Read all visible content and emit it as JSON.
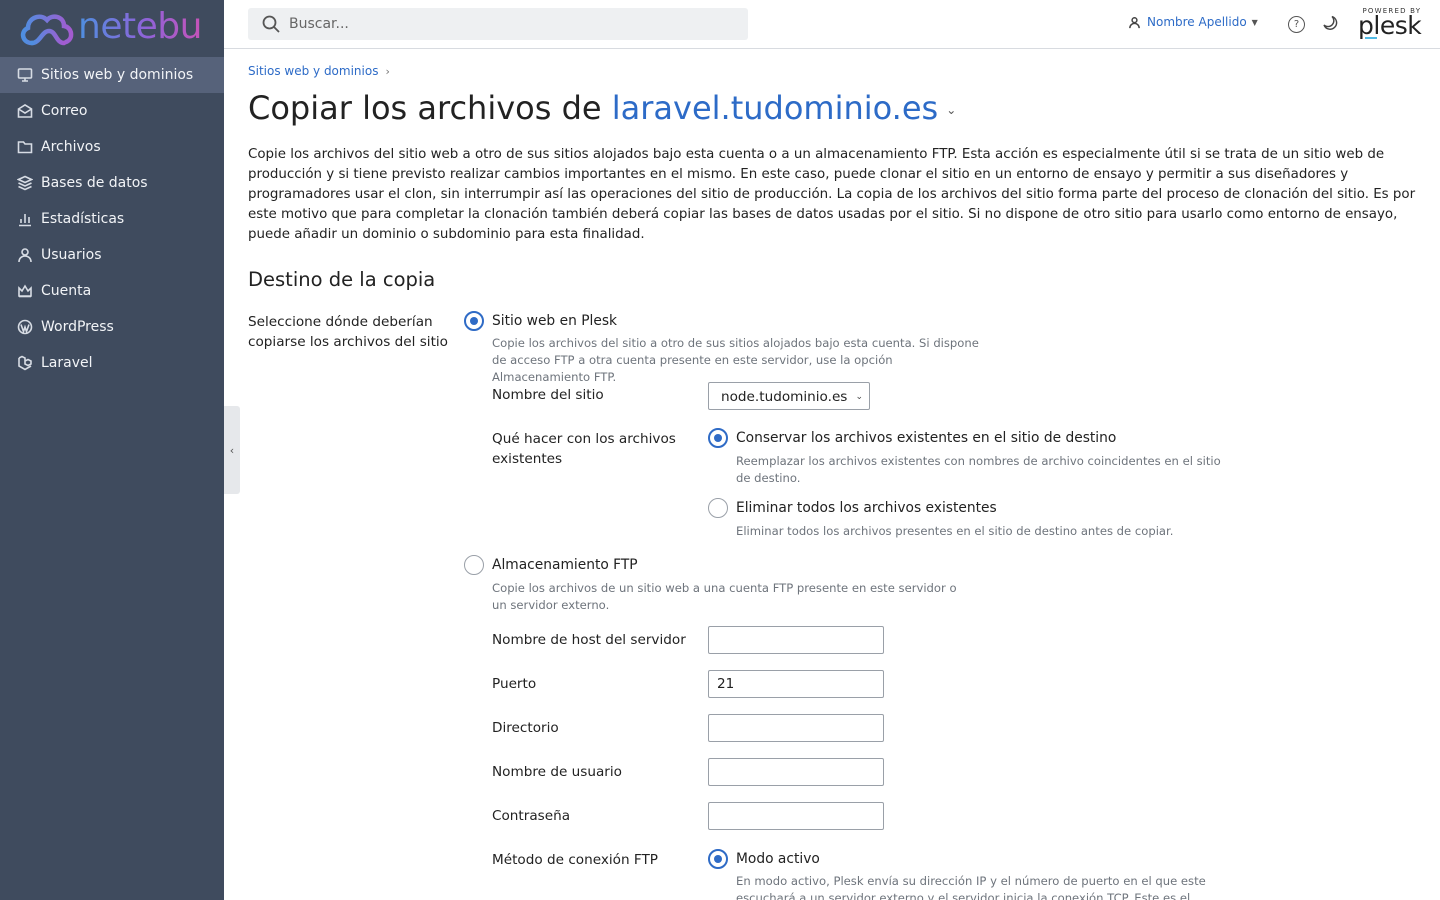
{
  "brand": {
    "logo_text": "netebu"
  },
  "sidebar": {
    "items": [
      {
        "label": "Sitios web y dominios",
        "icon": "monitor-icon",
        "active": true
      },
      {
        "label": "Correo",
        "icon": "mail-icon"
      },
      {
        "label": "Archivos",
        "icon": "folder-icon"
      },
      {
        "label": "Bases de datos",
        "icon": "database-icon"
      },
      {
        "label": "Estadísticas",
        "icon": "bar-chart-icon"
      },
      {
        "label": "Usuarios",
        "icon": "user-icon"
      },
      {
        "label": "Cuenta",
        "icon": "crown-icon"
      },
      {
        "label": "WordPress",
        "icon": "wordpress-icon"
      },
      {
        "label": "Laravel",
        "icon": "laravel-icon"
      }
    ]
  },
  "topbar": {
    "search_placeholder": "Buscar...",
    "user_name": "Nombre Apellido",
    "powered_by": "POWERED BY",
    "plesk_brand": "plesk"
  },
  "breadcrumb": {
    "item": "Sitios web y dominios"
  },
  "page": {
    "title_prefix": "Copiar los archivos de ",
    "title_domain": "laravel.tudominio.es",
    "intro": "Copie los archivos del sitio web a otro de sus sitios alojados bajo esta cuenta o a un almacenamiento FTP. Esta acción es especialmente útil si se trata de un sitio web de producción y si tiene previsto realizar cambios importantes en el mismo. En este caso, puede clonar el sitio en un entorno de ensayo y permitir a sus diseñadores y programadores usar el clon, sin interrumpir así las operaciones del sitio de producción. La copia de los archivos del sitio forma parte del proceso de clonación del sitio. Es por este motivo que para completar la clonación también deberá copiar las bases de datos usadas por el sitio. Si no dispone de otro sitio para usarlo como entorno de ensayo, puede añadir un dominio o subdominio para esta finalidad.",
    "section_title": "Destino de la copia"
  },
  "form": {
    "destination_label": "Seleccione dónde deberían copiarse los archivos del sitio",
    "plesk_option": {
      "label": "Sitio web en Plesk",
      "hint": "Copie los archivos del sitio a otro de sus sitios alojados bajo esta cuenta. Si dispone de acceso FTP a otra cuenta presente en este servidor, use la opción Almacenamiento FTP.",
      "checked": true
    },
    "site_name_label": "Nombre del sitio",
    "site_name_value": "node.tudominio.es",
    "existing_files_label": "Qué hacer con los archivos existentes",
    "keep_option": {
      "label": "Conservar los archivos existentes en el sitio de destino",
      "hint": "Reemplazar los archivos existentes con nombres de archivo coincidentes en el sitio de destino.",
      "checked": true
    },
    "delete_option": {
      "label": "Eliminar todos los archivos existentes",
      "hint": "Eliminar todos los archivos presentes en el sitio de destino antes de copiar.",
      "checked": false
    },
    "ftp_option": {
      "label": "Almacenamiento FTP",
      "hint": "Copie los archivos de un sitio web a una cuenta FTP presente en este servidor o un servidor externo.",
      "checked": false
    },
    "host_label": "Nombre de host del servidor",
    "host_value": "",
    "port_label": "Puerto",
    "port_value": "21",
    "directory_label": "Directorio",
    "directory_value": "",
    "username_label": "Nombre de usuario",
    "username_value": "",
    "password_label": "Contraseña",
    "password_value": "",
    "ftp_method_label": "Método de conexión FTP",
    "active_mode": {
      "label": "Modo activo",
      "hint": "En modo activo, Plesk envía su dirección IP y el número de puerto en el que este escuchará a un servidor externo y el servidor inicia la conexión TCP. Este es el modo",
      "checked": true
    }
  }
}
